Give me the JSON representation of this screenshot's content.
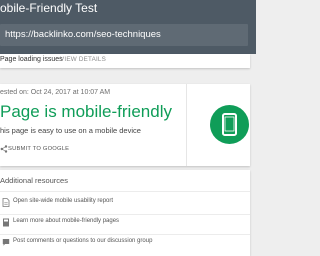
{
  "header": {
    "title": "obile-Friendly Test",
    "url": "https://backlinko.com/seo-techniques"
  },
  "issues": {
    "label": "Page loading issues",
    "action_label": "VIEW DETAILS"
  },
  "result": {
    "tested_on": "ested on: Oct 24, 2017 at 10:07 AM",
    "headline": "Page is mobile-friendly",
    "subline": "his page is easy to use on a mobile device",
    "submit_label": "SUBMIT TO GOOGLE",
    "status_icon": "mobile-phone-icon"
  },
  "resources": {
    "title": "Additional resources",
    "items": [
      {
        "label": "Open site-wide mobile usability report",
        "icon": "document-icon"
      },
      {
        "label": "Learn more about mobile-friendly pages",
        "icon": "book-icon"
      },
      {
        "label": "Post comments or questions to our discussion group",
        "icon": "chat-icon"
      }
    ]
  },
  "colors": {
    "header_bg": "#4e5a65",
    "url_bar_bg": "#5f6a74",
    "success_green": "#0f9d58",
    "page_bg": "#eeeeee"
  }
}
